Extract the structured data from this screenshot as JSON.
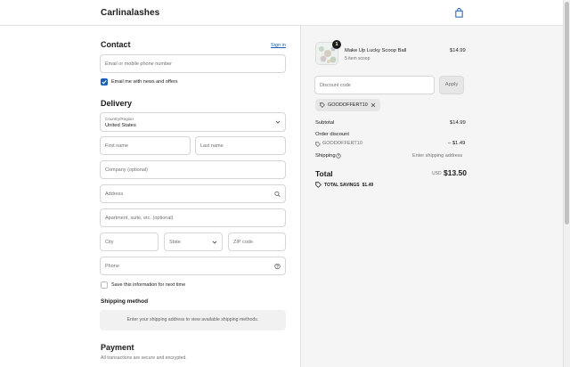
{
  "store": {
    "name": "Carlinalashes"
  },
  "contact": {
    "title": "Contact",
    "sign_in": "Sign in",
    "email_placeholder": "Email or mobile phone number",
    "news_label": "Email me with news and offers"
  },
  "delivery": {
    "title": "Delivery",
    "country_label": "Country/Region",
    "country_value": "United States",
    "first_name": "First name",
    "last_name": "Last name",
    "company": "Company (optional)",
    "address": "Address",
    "apartment": "Apartment, suite, etc. (optional)",
    "city": "City",
    "state": "State",
    "zip": "ZIP code",
    "phone": "Phone",
    "save_info": "Save this information for next time"
  },
  "shipping_method": {
    "title": "Shipping method",
    "notice": "Enter your shipping address to view available shipping methods."
  },
  "payment": {
    "title": "Payment",
    "subtitle": "All transactions are secure and encrypted."
  },
  "summary": {
    "product": {
      "name": "Make Up Lucky Scoop Ball",
      "variant": "5 item scoop",
      "price": "$14.99",
      "quantity": "1"
    },
    "discount_placeholder": "Discount code",
    "apply": "Apply",
    "applied_code": "GOODOFFERT10",
    "subtotal_label": "Subtotal",
    "subtotal_value": "$14.99",
    "order_discount_label": "Order discount",
    "order_discount_code": "GOODOFFERT10",
    "order_discount_value": "– $1.49",
    "shipping_label": "Shipping",
    "shipping_value": "Enter shipping address",
    "total_label": "Total",
    "currency": "USD",
    "total_value": "$13.50",
    "savings_label": "TOTAL SAVINGS",
    "savings_value": "$1.49"
  },
  "icons": {
    "bag": "shopping-bag-icon",
    "chevron": "chevron-down-icon",
    "search": "search-icon",
    "help": "help-icon",
    "tag": "tag-icon",
    "close": "close-icon"
  },
  "colors": {
    "accent": "#1a5fb4",
    "summary_bg": "#f5f5f5"
  }
}
